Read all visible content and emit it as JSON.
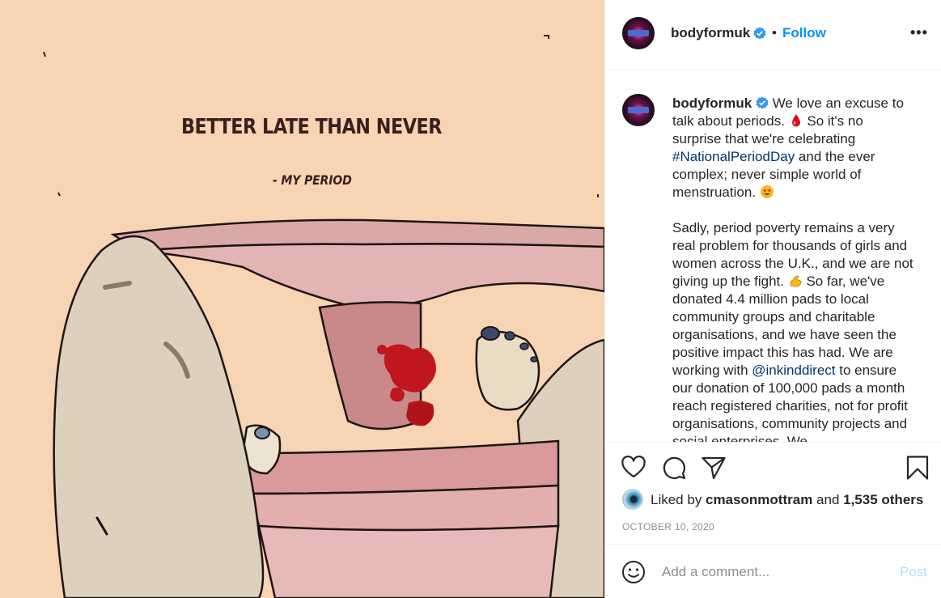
{
  "image": {
    "headline": "BETTER LATE THAN NEVER",
    "subline": "- MY PERIOD"
  },
  "header": {
    "username": "bodyformuk",
    "separator": "•",
    "follow_label": "Follow",
    "more_label": "•••"
  },
  "caption": {
    "username": "bodyformuk",
    "p1_part1": " We love an excuse to talk about periods. ",
    "p1_part2": " So it's no surprise that we're celebrating ",
    "hashtag": "#NationalPeriodDay",
    "p1_part3": " and the ever complex; never simple world of menstruation. ",
    "p2_part1": "Sadly, period poverty remains a very real problem for thousands of girls and women across the U.K., and we are not giving up the fight. ",
    "p2_part2": " So far, we've donated 4.4 million pads to local community groups and charitable organisations, and we have seen the positive impact this has had. We are working with ",
    "mention": "@inkinddirect",
    "p2_part3": " to ensure our donation of 100,000 pads a month reach registered charities, not for profit organisations, community projects and social enterprises. We"
  },
  "likes": {
    "prefix": "Liked by ",
    "user": "cmasonmottram",
    "middle": " and ",
    "count": "1,535 others"
  },
  "date": "OCTOBER 10, 2020",
  "comment": {
    "placeholder": "Add a comment...",
    "post_label": "Post"
  },
  "colors": {
    "link_blue": "#0095f6",
    "hashtag_blue": "#00376b",
    "post_disabled": "#b2dffc",
    "image_bg": "#f6d4b4"
  }
}
